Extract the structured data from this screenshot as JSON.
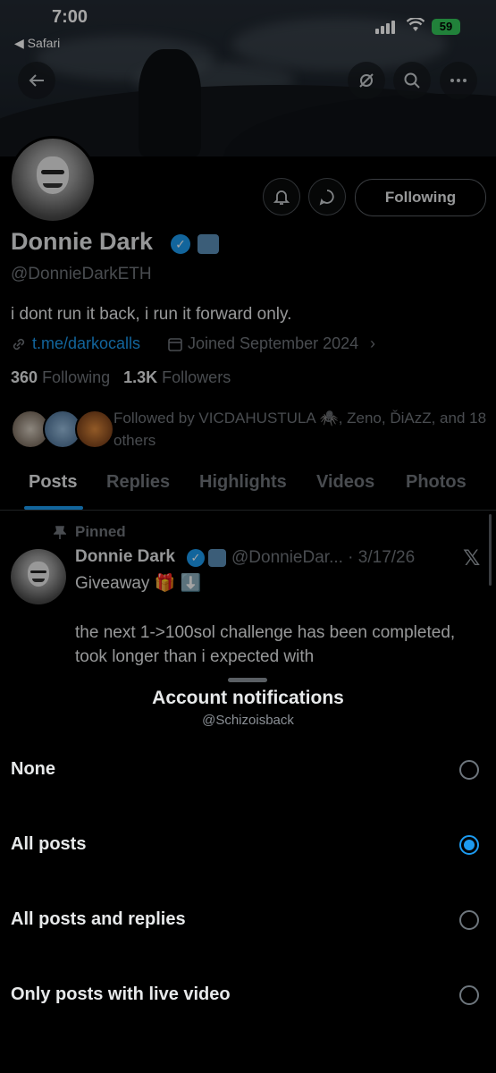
{
  "status_bar": {
    "time": "7:00",
    "back_app": "◀ Safari",
    "battery": "59"
  },
  "profile": {
    "name": "Donnie Dark",
    "handle": "@DonnieDarkETH",
    "bio": "i dont run it back, i run it forward only.",
    "link": "t.me/darkocalls",
    "joined": "Joined September 2024",
    "following_count": "360",
    "following_label": "Following",
    "followers_count": "1.3K",
    "followers_label": "Followers",
    "followed_by": "Followed by VICDAHUSTULA 🕷️, Zeno, ĎiAzZ, and 18 others",
    "follow_button": "Following"
  },
  "tabs": [
    "Posts",
    "Replies",
    "Highlights",
    "Videos",
    "Photos"
  ],
  "pinned_post": {
    "pinned_label": "Pinned",
    "author": "Donnie Dark",
    "handle_date": "@DonnieDar... · 3/17/26",
    "text": "Giveaway 🎁 ⬇️",
    "body": "the next 1->100sol challenge has been completed, took longer than i expected with"
  },
  "sheet": {
    "title": "Account notifications",
    "subtitle": "@Schizoisback",
    "options": [
      {
        "label": "None",
        "selected": false
      },
      {
        "label": "All posts",
        "selected": true
      },
      {
        "label": "All posts and replies",
        "selected": false
      },
      {
        "label": "Only posts with live video",
        "selected": false
      }
    ]
  },
  "colors": {
    "accent": "#1d9bf0",
    "background": "#000000",
    "muted": "#71767b",
    "battery": "#34c759"
  }
}
